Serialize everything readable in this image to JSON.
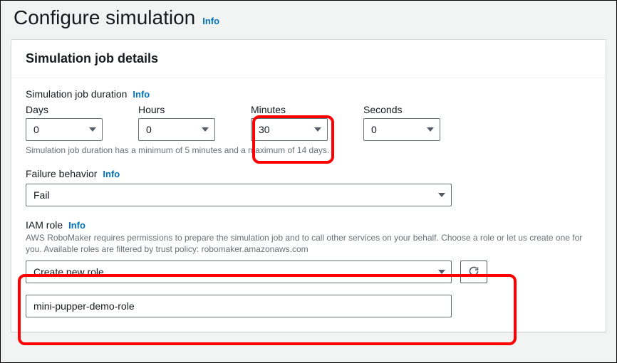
{
  "header": {
    "title": "Configure simulation",
    "info": "Info"
  },
  "panel": {
    "title": "Simulation job details"
  },
  "duration": {
    "label": "Simulation job duration",
    "info": "Info",
    "days_label": "Days",
    "hours_label": "Hours",
    "minutes_label": "Minutes",
    "seconds_label": "Seconds",
    "days_value": "0",
    "hours_value": "0",
    "minutes_value": "30",
    "seconds_value": "0",
    "hint": "Simulation job duration has a minimum of 5 minutes and a maximum of 14 days."
  },
  "failure": {
    "label": "Failure behavior",
    "info": "Info",
    "value": "Fail"
  },
  "iam": {
    "label": "IAM role",
    "info": "Info",
    "desc": "AWS RoboMaker requires permissions to prepare the simulation job and to call other services on your behalf. Choose a role or let us create one for you. Available roles are filtered by trust policy: robomaker.amazonaws.com",
    "select_value": "Create new role",
    "role_name_value": "mini-pupper-demo-role"
  }
}
